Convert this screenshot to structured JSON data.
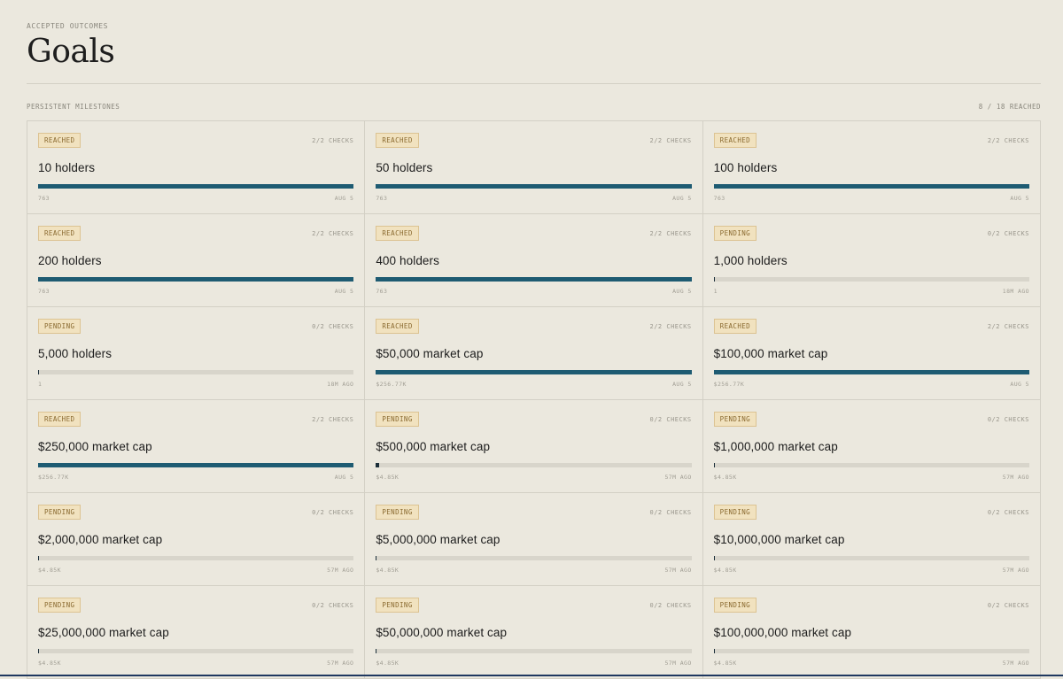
{
  "header": {
    "eyebrow": "ACCEPTED OUTCOMES",
    "title": "Goals"
  },
  "section": {
    "label": "PERSISTENT MILESTONES",
    "count": "8 / 18 REACHED"
  },
  "colors": {
    "background": "#ebe8de",
    "bar_fill": "#1e5b72",
    "bar_track": "#d8d5cb",
    "badge_bg": "#f1e2bf",
    "badge_text": "#8a6a30"
  },
  "goals": [
    {
      "status": "REACHED",
      "checks": "2/2 CHECKS",
      "name": "10 holders",
      "progress": 1.0,
      "value": "763",
      "time": "AUG 5"
    },
    {
      "status": "REACHED",
      "checks": "2/2 CHECKS",
      "name": "50 holders",
      "progress": 1.0,
      "value": "763",
      "time": "AUG 5"
    },
    {
      "status": "REACHED",
      "checks": "2/2 CHECKS",
      "name": "100 holders",
      "progress": 1.0,
      "value": "763",
      "time": "AUG 5"
    },
    {
      "status": "REACHED",
      "checks": "2/2 CHECKS",
      "name": "200 holders",
      "progress": 1.0,
      "value": "763",
      "time": "AUG 5"
    },
    {
      "status": "REACHED",
      "checks": "2/2 CHECKS",
      "name": "400 holders",
      "progress": 1.0,
      "value": "763",
      "time": "AUG 5"
    },
    {
      "status": "PENDING",
      "checks": "0/2 CHECKS",
      "name": "1,000 holders",
      "progress": 0.001,
      "value": "1",
      "time": "18M AGO"
    },
    {
      "status": "PENDING",
      "checks": "0/2 CHECKS",
      "name": "5,000 holders",
      "progress": 0.0002,
      "value": "1",
      "time": "18M AGO"
    },
    {
      "status": "REACHED",
      "checks": "2/2 CHECKS",
      "name": "$50,000 market cap",
      "progress": 1.0,
      "value": "$256.77K",
      "time": "AUG 5"
    },
    {
      "status": "REACHED",
      "checks": "2/2 CHECKS",
      "name": "$100,000 market cap",
      "progress": 1.0,
      "value": "$256.77K",
      "time": "AUG 5"
    },
    {
      "status": "REACHED",
      "checks": "2/2 CHECKS",
      "name": "$250,000 market cap",
      "progress": 1.0,
      "value": "$256.77K",
      "time": "AUG 5"
    },
    {
      "status": "PENDING",
      "checks": "0/2 CHECKS",
      "name": "$500,000 market cap",
      "progress": 0.0097,
      "value": "$4.85K",
      "time": "57M AGO"
    },
    {
      "status": "PENDING",
      "checks": "0/2 CHECKS",
      "name": "$1,000,000 market cap",
      "progress": 0.00485,
      "value": "$4.85K",
      "time": "57M AGO"
    },
    {
      "status": "PENDING",
      "checks": "0/2 CHECKS",
      "name": "$2,000,000 market cap",
      "progress": 0.0024,
      "value": "$4.85K",
      "time": "57M AGO"
    },
    {
      "status": "PENDING",
      "checks": "0/2 CHECKS",
      "name": "$5,000,000 market cap",
      "progress": 0.001,
      "value": "$4.85K",
      "time": "57M AGO"
    },
    {
      "status": "PENDING",
      "checks": "0/2 CHECKS",
      "name": "$10,000,000 market cap",
      "progress": 0.0005,
      "value": "$4.85K",
      "time": "57M AGO"
    },
    {
      "status": "PENDING",
      "checks": "0/2 CHECKS",
      "name": "$25,000,000 market cap",
      "progress": 0.0002,
      "value": "$4.85K",
      "time": "57M AGO"
    },
    {
      "status": "PENDING",
      "checks": "0/2 CHECKS",
      "name": "$50,000,000 market cap",
      "progress": 0.0001,
      "value": "$4.85K",
      "time": "57M AGO"
    },
    {
      "status": "PENDING",
      "checks": "0/2 CHECKS",
      "name": "$100,000,000 market cap",
      "progress": 5e-05,
      "value": "$4.85K",
      "time": "57M AGO"
    }
  ]
}
